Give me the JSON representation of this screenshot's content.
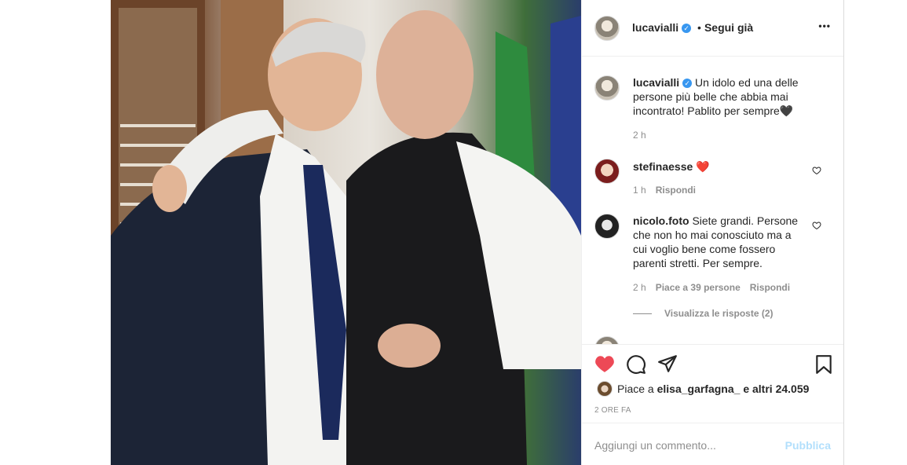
{
  "post": {
    "image_alt": "Foto",
    "username": "lucavialli",
    "follow_label": "Segui già",
    "more_label": "•••",
    "caption": "Un idolo ed una delle persone più belle che abbia mai incontrato! Pablito per sempre🖤",
    "caption_time": "2 h"
  },
  "comments": [
    {
      "username": "stefinaesse",
      "text": "❤️",
      "time": "1 h",
      "reply_label": "Rispondi"
    },
    {
      "username": "nicolo.foto",
      "text": "Siete grandi. Persone che non ho mai conosciuto ma a cui voglio bene come fossero parenti stretti. Per sempre.",
      "time": "2 h",
      "likes_label": "Piace a 39 persone",
      "reply_label": "Rispondi",
      "view_replies": "Visualizza le risposte (2)"
    }
  ],
  "likes": {
    "prefix": "Piace a ",
    "user": "elisa_garfagna_",
    "suffix": " e altri 24.059"
  },
  "timestamp": "2 ORE FA",
  "add_comment": {
    "placeholder": "Aggiungi un commento...",
    "publish_label": "Pubblica"
  },
  "colors": {
    "like_red": "#ed4956",
    "verified_blue": "#3897f0",
    "publish_disabled": "#b2dffc",
    "muted": "#8e8e8e"
  }
}
